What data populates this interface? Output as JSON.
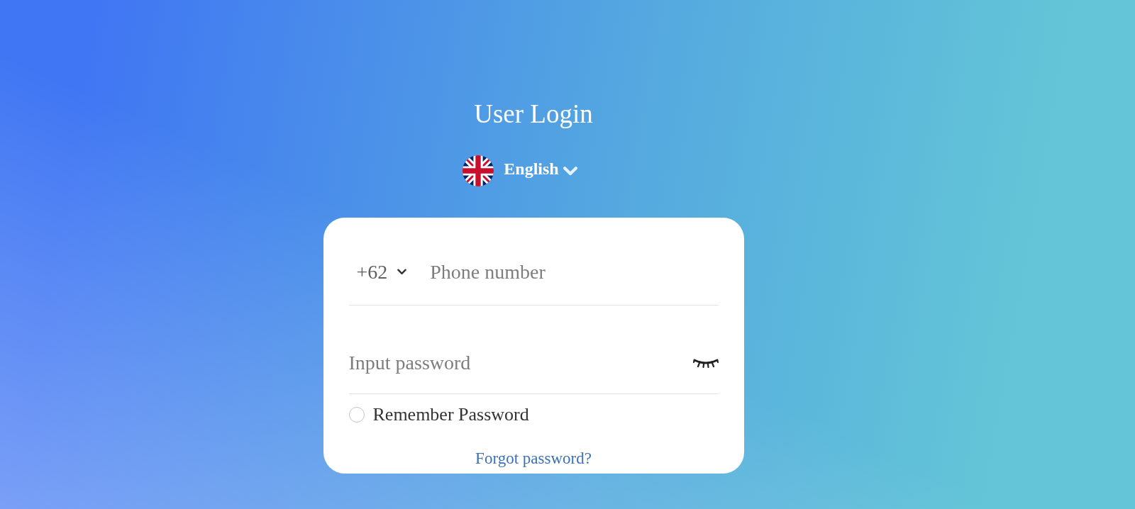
{
  "page": {
    "title": "User Login"
  },
  "language": {
    "label": "English"
  },
  "login_form": {
    "country_code": "+62",
    "phone": {
      "placeholder": "Phone number"
    },
    "password": {
      "placeholder": "Input password",
      "visible": false
    },
    "remember_password": {
      "label": "Remember Password",
      "checked": false
    },
    "forgot_password": "Forgot password?"
  }
}
